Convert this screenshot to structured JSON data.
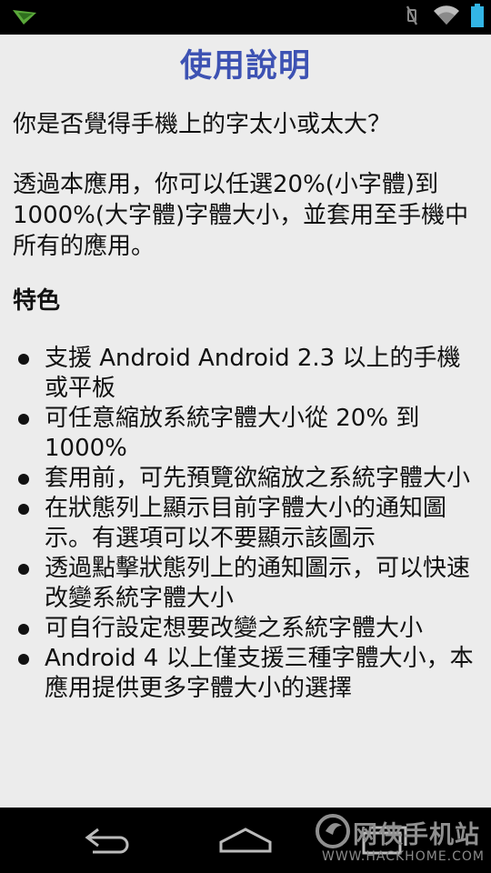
{
  "status_bar": {
    "icons": [
      "notification-arrow-icon",
      "vibrate-icon",
      "wifi-icon",
      "battery-icon"
    ],
    "battery_color": "#33b5e5"
  },
  "page": {
    "title": "使用說明",
    "title_color": "#3d52b3",
    "question": "你是否覺得手機上的字太小或太大？",
    "description": "透過本應用，你可以任選20%(小字體)到1000%(大字體)字體大小，並套用至手機中所有的應用。",
    "features_heading": "特色",
    "features": [
      "支援 Android Android 2.3 以上的手機或平板",
      "可任意縮放系統字體大小從 20% 到 1000%",
      "套用前，可先預覽欲縮放之系統字體大小",
      "在狀態列上顯示目前字體大小的通知圖示。有選項可以不要顯示該圖示",
      "透過點擊狀態列上的通知圖示，可以快速改變系統字體大小",
      "可自行設定想要改變之系統字體大小",
      "Android 4 以上僅支援三種字體大小，本應用提供更多字體大小的選擇"
    ]
  },
  "nav_bar": {
    "buttons": [
      "back-icon",
      "home-icon",
      "recents-icon"
    ]
  },
  "watermark": {
    "name": "网侠手机站",
    "url": "WWW.HACKHOME.COM"
  }
}
